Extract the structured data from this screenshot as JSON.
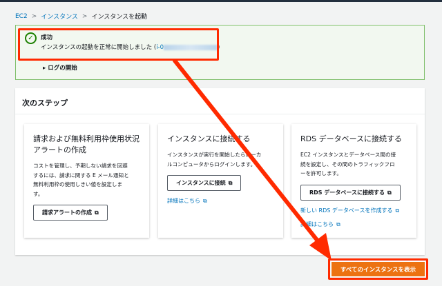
{
  "breadcrumb": {
    "items": [
      "EC2",
      "インスタンス"
    ],
    "current": "インスタンスを起動"
  },
  "alert": {
    "title": "成功",
    "message_prefix": "インスタンスの起動を正常に開始しました (",
    "instance_id_prefix": "i-0",
    "message_suffix": ")",
    "log_toggle": "ログの開始"
  },
  "next_steps": {
    "title": "次のステップ",
    "cards": [
      {
        "title": "請求および無料利用枠使用状況\nアラートの作成",
        "desc": "コストを管理し、予期しない請求を回避\nするには、請求に関する E メール通知と\n無料利用枠の使用しきい値を設定しま\nす。",
        "button": "請求アラートの作成"
      },
      {
        "title": "インスタンスに接続する",
        "desc": "インスタンスが実行を開始したらローカ\nルコンピュータからログインします。",
        "button": "インスタンスに接続",
        "link": "詳細はこちら"
      },
      {
        "title": "RDS データベースに接続する",
        "desc": "EC2 インスタンスとデータベース間の接\n続を設定し、その間のトラフィックフロ\nーを許可します。",
        "button": "RDS データベースに接続する",
        "link": "新しい RDS データベースを作成する",
        "link2": "詳細はこちら"
      }
    ]
  },
  "primary_button": "すべてのインスタンスを表示",
  "colors": {
    "annotation": "#ff2a00",
    "primary": "#ec7211",
    "success": "#1d8102",
    "link": "#0073bb"
  }
}
